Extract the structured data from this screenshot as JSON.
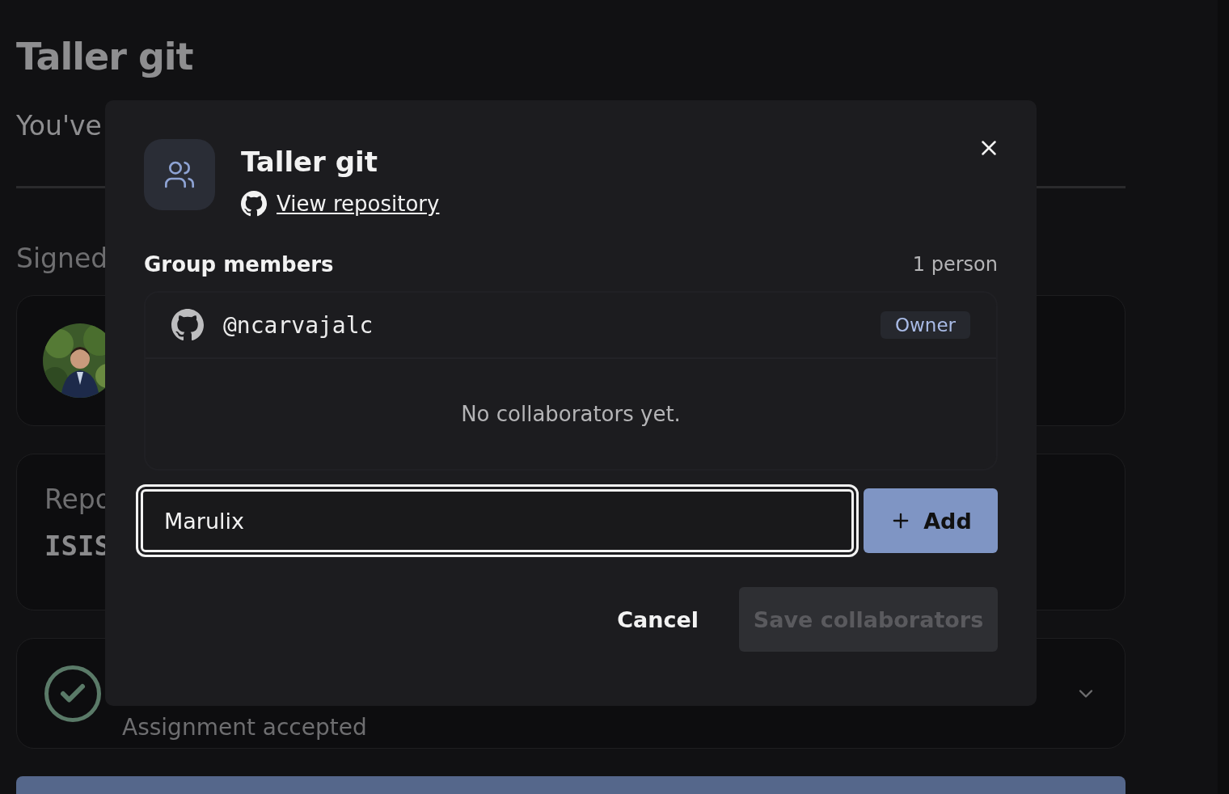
{
  "page": {
    "title": "Taller git",
    "intro": "You've",
    "section_label": "Signed",
    "repo_label": "Repo",
    "repo_name": "ISIS",
    "status": "Assignment accepted"
  },
  "dialog": {
    "title": "Taller git",
    "repo_link": "View repository",
    "members_heading": "Group members",
    "member_count": "1 person",
    "members": [
      {
        "handle": "@ncarvajalc",
        "role": "Owner"
      }
    ],
    "empty_message": "No collaborators yet.",
    "input": {
      "value": "Marulix"
    },
    "add_button": "Add",
    "cancel_button": "Cancel",
    "save_button": {
      "label": "Save collaborators",
      "disabled": true
    }
  }
}
